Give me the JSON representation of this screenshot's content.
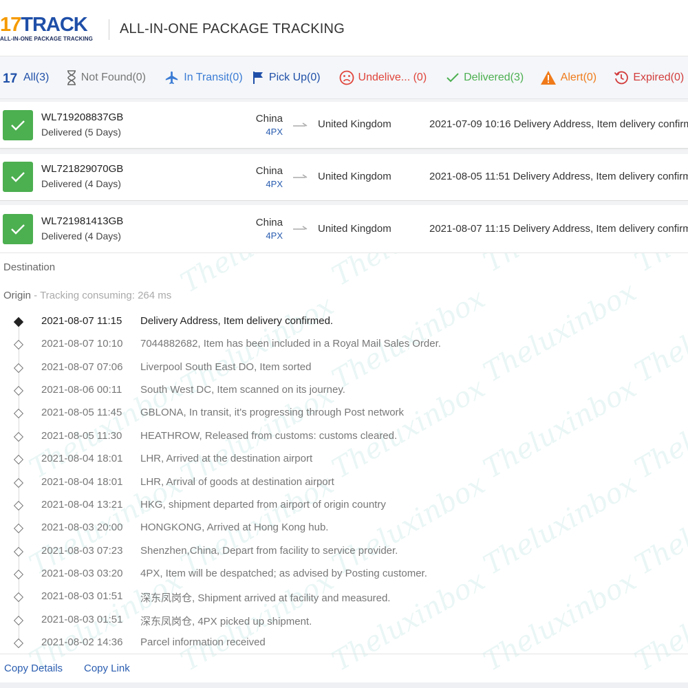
{
  "header": {
    "logo_num": "17",
    "logo_word": "TRACK",
    "logo_tagline": "ALL-IN-ONE PACKAGE TRACKING",
    "title": "ALL-IN-ONE PACKAGE TRACKING"
  },
  "tabs": [
    {
      "label": "All(3)",
      "icon": "17track-logo-icon",
      "color": "#1f4fa8"
    },
    {
      "label": "Not Found(0)",
      "icon": "hourglass-icon",
      "color": "#777777"
    },
    {
      "label": "In Transit(0)",
      "icon": "airplane-icon",
      "color": "#3a7bd5"
    },
    {
      "label": "Pick Up(0)",
      "icon": "flag-icon",
      "color": "#1f4fa8"
    },
    {
      "label": "Undelive... (0)",
      "icon": "sad-face-icon",
      "color": "#e0433a"
    },
    {
      "label": "Delivered(3)",
      "icon": "checkmark-icon",
      "color": "#4caf50"
    },
    {
      "label": "Alert(0)",
      "icon": "warning-icon",
      "color": "#f07a1a"
    },
    {
      "label": "Expired(0)",
      "icon": "history-clock-icon",
      "color": "#d23c3c"
    }
  ],
  "shipments": [
    {
      "number": "WL719208837GB",
      "status": "Delivered (5 Days)",
      "origin": "China",
      "carrier": "4PX",
      "destination": "United Kingdom",
      "last_time": "2021-07-09 10:16",
      "last_event": "Delivery Address, Item delivery confirmed."
    },
    {
      "number": "WL721829070GB",
      "status": "Delivered (4 Days)",
      "origin": "China",
      "carrier": "4PX",
      "destination": "United Kingdom",
      "last_time": "2021-08-05 11:51",
      "last_event": "Delivery Address, Item delivery confirmed."
    },
    {
      "number": "WL721981413GB",
      "status": "Delivered (4 Days)",
      "origin": "China",
      "carrier": "4PX",
      "destination": "United Kingdom",
      "last_time": "2021-08-07 11:15",
      "last_event": "Delivery Address, Item delivery confirmed."
    }
  ],
  "detail": {
    "destination_label": "Destination",
    "origin_label": "Origin",
    "origin_separator": " - ",
    "consuming": "Tracking consuming: 264 ms",
    "events": [
      {
        "time": "2021-08-07 11:15",
        "desc": "Delivery Address, Item delivery confirmed."
      },
      {
        "time": "2021-08-07 10:10",
        "desc": "7044882682, Item has been included in a Royal Mail Sales Order."
      },
      {
        "time": "2021-08-07 07:06",
        "desc": "Liverpool South East DO, Item sorted"
      },
      {
        "time": "2021-08-06 00:11",
        "desc": "South West DC, Item scanned on its journey."
      },
      {
        "time": "2021-08-05 11:45",
        "desc": "GBLONA, In transit, it's progressing through Post network"
      },
      {
        "time": "2021-08-05 11:30",
        "desc": "HEATHROW, Released from customs: customs cleared."
      },
      {
        "time": "2021-08-04 18:01",
        "desc": "LHR, Arrived at the destination airport"
      },
      {
        "time": "2021-08-04 18:01",
        "desc": "LHR, Arrival of goods at destination airport"
      },
      {
        "time": "2021-08-04 13:21",
        "desc": "HKG, shipment departed from airport of origin country"
      },
      {
        "time": "2021-08-03 20:00",
        "desc": "HONGKONG, Arrived at Hong Kong hub."
      },
      {
        "time": "2021-08-03 07:23",
        "desc": "Shenzhen,China, Depart from facility to service provider."
      },
      {
        "time": "2021-08-03 03:20",
        "desc": "4PX, Item will be despatched; as advised by Posting customer."
      },
      {
        "time": "2021-08-03 01:51",
        "desc": "深东凤岗仓, Shipment arrived at facility and measured."
      },
      {
        "time": "2021-08-03 01:51",
        "desc": "深东凤岗仓, 4PX picked up shipment."
      },
      {
        "time": "2021-08-02 14:36",
        "desc": "Parcel information received"
      }
    ]
  },
  "footer": {
    "copy_details": "Copy Details",
    "copy_link": "Copy Link"
  },
  "watermark": "Theluxinbox"
}
